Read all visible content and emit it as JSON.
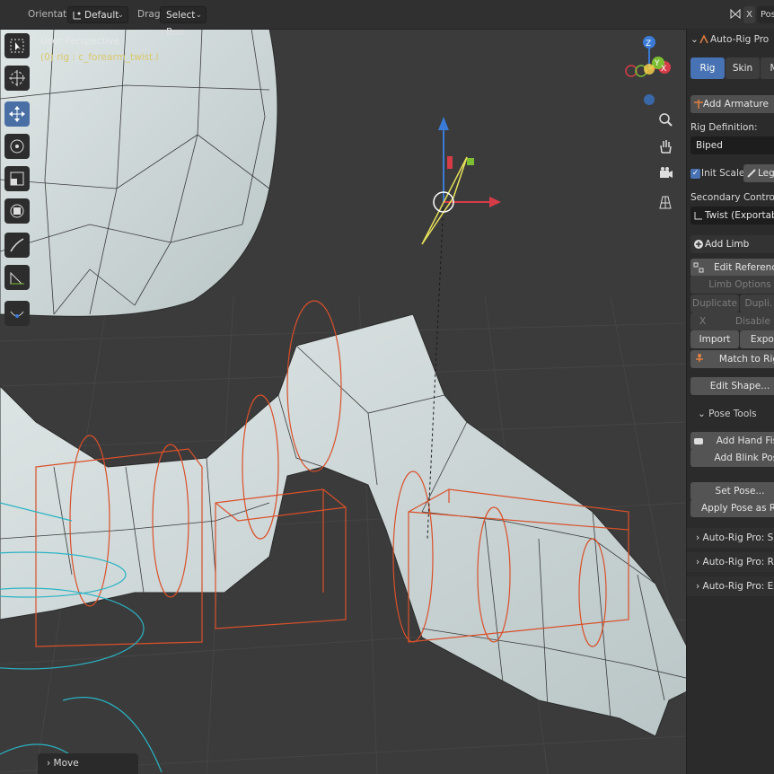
{
  "header": {
    "orientation_label": "Orientation:",
    "orientation_value": "Default",
    "drag_label": "Drag:",
    "drag_value": "Select Box",
    "mode_x": "X",
    "mode_value": "Pose"
  },
  "viewport": {
    "perspective": "User Perspective",
    "selection": "(0) rig : c_forearm_twist.l"
  },
  "toolbar": {
    "tools": [
      "select-box-icon",
      "cursor-icon",
      "move-icon",
      "rotate-icon",
      "scale-icon",
      "transform-icon",
      "annotate-icon",
      "measure-icon",
      "pose-tool-icon"
    ],
    "active": "move-icon"
  },
  "gizmo": {
    "z": "Z",
    "y": "Y",
    "x": "X",
    "colors": {
      "x": "#d63c48",
      "y": "#7cbd34",
      "z": "#3b7bd6"
    }
  },
  "npanel": {
    "title": "Auto-Rig Pro",
    "tabs": [
      "Rig",
      "Skin",
      "M"
    ],
    "active_tab": "Rig",
    "add_armature": "Add Armature",
    "rig_definition_label": "Rig Definition:",
    "rig_definition_value": "Biped",
    "init_scale": "Init Scale",
    "legacy": "Lega",
    "secondary_label": "Secondary Controllers:",
    "secondary_value": "Twist (Exportable, bes",
    "add_limb": "Add Limb",
    "edit_reference": "Edit Reference Bone",
    "limb_options": "Limb Options",
    "duplicate": "Duplicate",
    "dupli_m": "Dupli. M",
    "x_label": "X",
    "disable": "Disable",
    "import": "Import",
    "export": "Expor",
    "match_to_rig": "Match to Rig",
    "edit_shape": "Edit Shape...",
    "pose_tools": "Pose Tools",
    "add_hand_fist": "Add Hand Fist",
    "add_blink_pose": "Add Blink Pose",
    "set_pose": "Set Pose...",
    "apply_pose": "Apply Pose as Rest Pos",
    "smart": "Auto-Rig Pro: Smart",
    "remap": "Auto-Rig Pro: Remap",
    "export_section": "Auto-Rig Pro: Export"
  },
  "operator_panel": {
    "label": "Move"
  }
}
